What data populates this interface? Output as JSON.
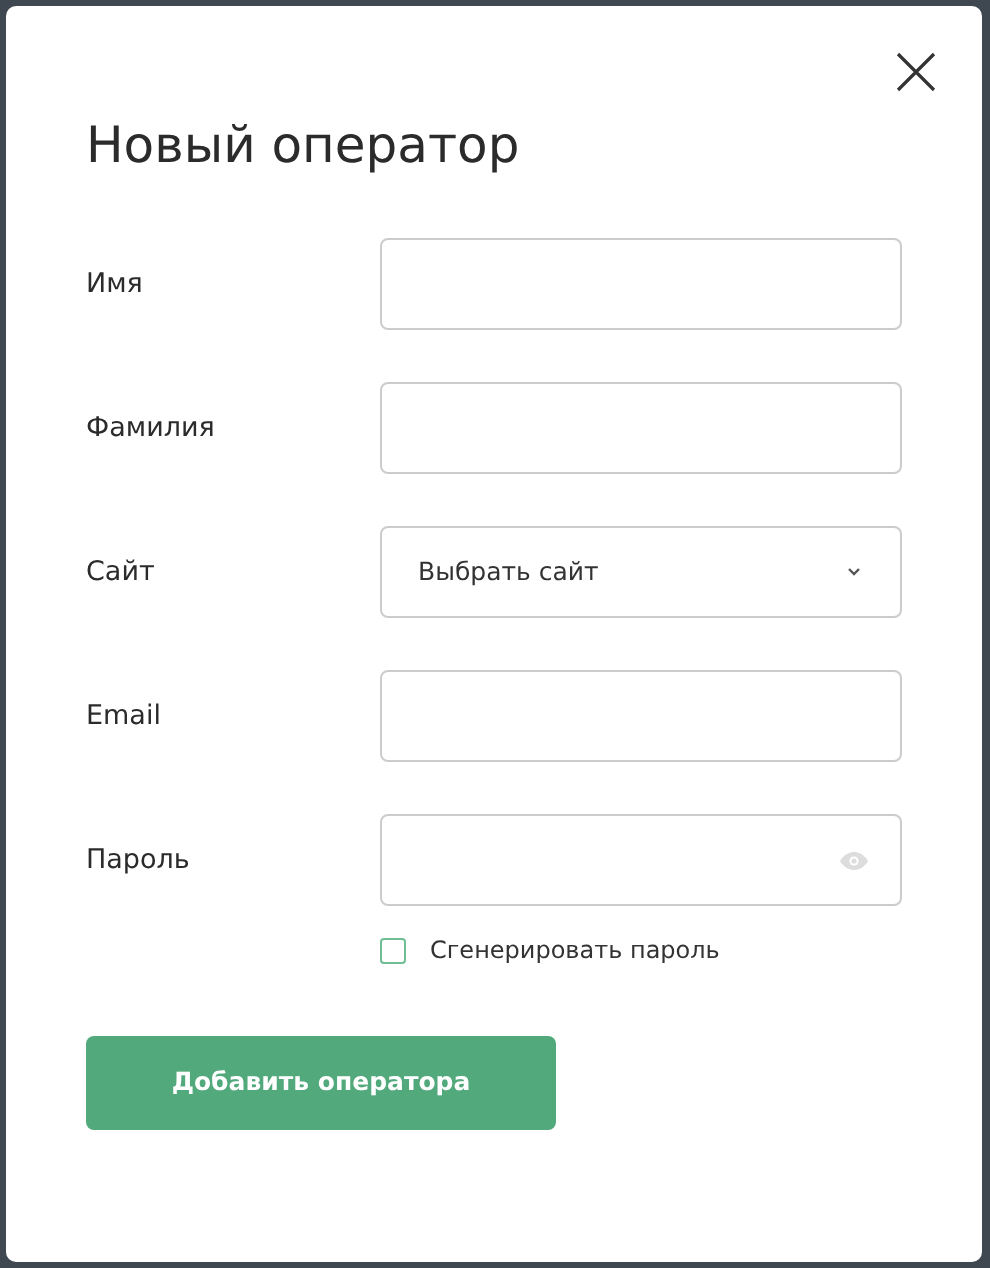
{
  "dialog": {
    "title": "Новый оператор"
  },
  "fields": [
    {
      "label": "Имя",
      "kind": "text"
    },
    {
      "label": "Фамилия",
      "kind": "text"
    },
    {
      "label": "Сайт",
      "kind": "select",
      "value": "Выбрать сайт"
    },
    {
      "label": "Email",
      "kind": "text"
    },
    {
      "label": "Пароль",
      "kind": "password"
    }
  ],
  "generate_password": {
    "label": "Сгенерировать пароль",
    "checked": false
  },
  "submit": "Добавить оператора"
}
